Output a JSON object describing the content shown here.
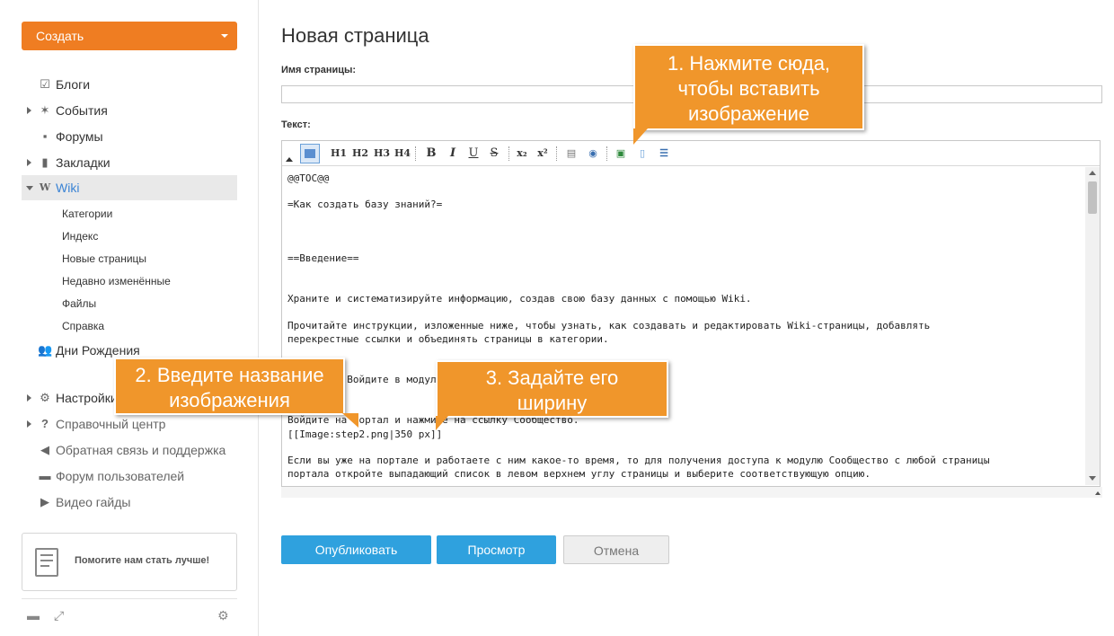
{
  "sidebar": {
    "create_label": "Создать",
    "items": [
      {
        "label": "Блоги",
        "icon": "blog-icon"
      },
      {
        "label": "События",
        "icon": "events-icon"
      },
      {
        "label": "Форумы",
        "icon": "forums-icon"
      },
      {
        "label": "Закладки",
        "icon": "bookmarks-icon"
      },
      {
        "label": "Wiki",
        "icon": "wiki-icon"
      },
      {
        "label": "Дни Рождения",
        "icon": "birthdays-icon"
      },
      {
        "label": "Настройки",
        "icon": "settings-icon"
      },
      {
        "label": "Справочный центр",
        "icon": "help-icon"
      },
      {
        "label": "Обратная связь и поддержка",
        "icon": "feedback-icon"
      },
      {
        "label": "Форум пользователей",
        "icon": "user-forum-icon"
      },
      {
        "label": "Видео гайды",
        "icon": "video-icon"
      }
    ],
    "wiki_sub": [
      "Категории",
      "Индекс",
      "Новые страницы",
      "Недавно изменённые",
      "Файлы",
      "Справка"
    ],
    "feedback_label": "Помогите нам стать лучше!"
  },
  "main": {
    "title": "Новая страница",
    "name_label": "Имя страницы:",
    "name_value": "",
    "text_label": "Текст:",
    "toolbar": [
      "H1",
      "H2",
      "H3",
      "H4",
      "B",
      "I",
      "U",
      "S"
    ],
    "lines": [
      "@@TOC@@",
      "=Как создать базу знаний?=",
      "==Введение==",
      "Храните и систематизируйте информацию, создав свою базу данных с помощью Wiki.",
      "Прочитайте инструкции, изложенные ниже, чтобы узнать, как создавать и редактировать Wiki-страницы, добавлять",
      "перекрестные ссылки и объединять страницы в категории.",
      "===Шаг 1. Войдите в модуль Сообщество===",
      "Войдите на портал и нажмите на ссылку Сообщество.",
      "[[Image:step2.png|350 px]]",
      "Если вы уже на портале и работаете с ним какое-то время, то для получения доступа к модулю Сообщество с любой страницы",
      "портала откройте выпадающий список в левом верхнем углу страницы и выберите соответствующую опцию."
    ],
    "publish_label": "Опубликовать",
    "preview_label": "Просмотр",
    "cancel_label": "Отмена"
  },
  "callouts": {
    "c1": [
      "1. Нажмите сюда,",
      "чтобы вставить",
      "изображение"
    ],
    "c2": [
      "2. Введите название",
      "изображения"
    ],
    "c3": [
      "3. Задайте его",
      "ширину"
    ]
  },
  "colors": {
    "accent": "#ef7d22",
    "primary": "#2fa1de",
    "callout": "#f0962b",
    "link": "#3a83d4"
  }
}
